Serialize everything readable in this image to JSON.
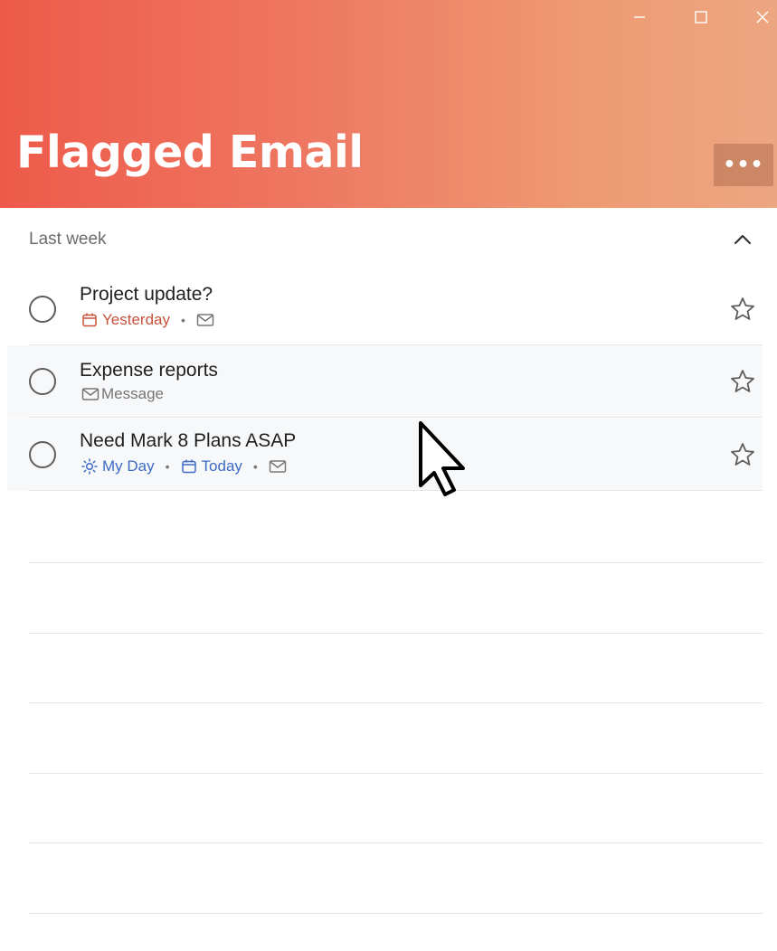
{
  "window": {
    "minimize_icon": "minimize-icon",
    "maximize_icon": "maximize-icon",
    "close_icon": "close-icon"
  },
  "header": {
    "title": "Flagged Email",
    "more_label": "•••",
    "gradient_colors": [
      "#ee5a4a",
      "#eda682"
    ]
  },
  "group": {
    "label": "Last week",
    "expanded": true
  },
  "tasks": [
    {
      "title": "Project update?",
      "due": "Yesterday",
      "due_color": "#c8523a",
      "has_email": true,
      "starred": false
    },
    {
      "title": "Expense reports",
      "email_label": "Message",
      "has_email": true,
      "starred": false
    },
    {
      "title": "Need Mark 8 Plans ASAP",
      "my_day": "My Day",
      "due": "Today",
      "due_color": "#3d6bc6",
      "has_email": true,
      "starred": false
    }
  ],
  "colors": {
    "accent_red": "#c8523a",
    "accent_blue": "#3d6bc6"
  }
}
